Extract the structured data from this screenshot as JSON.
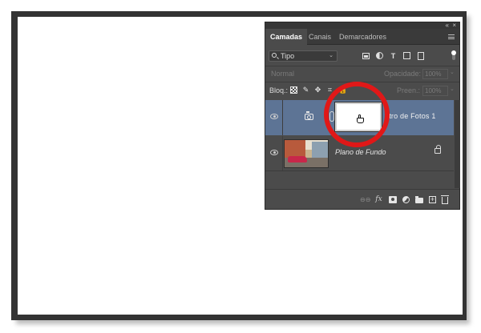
{
  "panel": {
    "top_icons": {
      "collapse": "«",
      "close": "×"
    },
    "tabs": [
      {
        "label": "Camadas",
        "active": true
      },
      {
        "label": "Canais",
        "active": false
      },
      {
        "label": "Demarcadores",
        "active": false
      }
    ],
    "filter": {
      "kind_value": "Tipo",
      "icon_names": [
        "pixel-layer-filter-icon",
        "adjustment-layer-filter-icon",
        "type-layer-filter-icon",
        "shape-layer-filter-icon",
        "smart-object-filter-icon"
      ],
      "type_glyph": "T"
    },
    "blend": {
      "mode": "Normal",
      "opacity_label": "Opacidade:",
      "opacity_value": "100%"
    },
    "lock": {
      "label": "Bloq.:",
      "fill_label": "Preen.:",
      "fill_value": "100%"
    },
    "layers": [
      {
        "name": "Filtro de Fotos 1",
        "visible_name": "ltro de Fotos 1",
        "kind": "adjustment",
        "selected": true,
        "has_mask": true
      },
      {
        "name": "Plano de Fundo",
        "kind": "background",
        "selected": false,
        "locked": true
      }
    ],
    "bottom_icons": {
      "link": "⊖⊖",
      "fx": "fx",
      "names": [
        "link-layers-icon",
        "layer-style-icon",
        "add-mask-icon",
        "adjustment-layer-icon",
        "new-group-icon",
        "new-layer-icon",
        "delete-layer-icon"
      ]
    }
  },
  "colors": {
    "panel_bg": "#4b4b4b",
    "selected_layer": "#5d7495",
    "highlight_ring": "#e01818",
    "frame": "#333333"
  }
}
